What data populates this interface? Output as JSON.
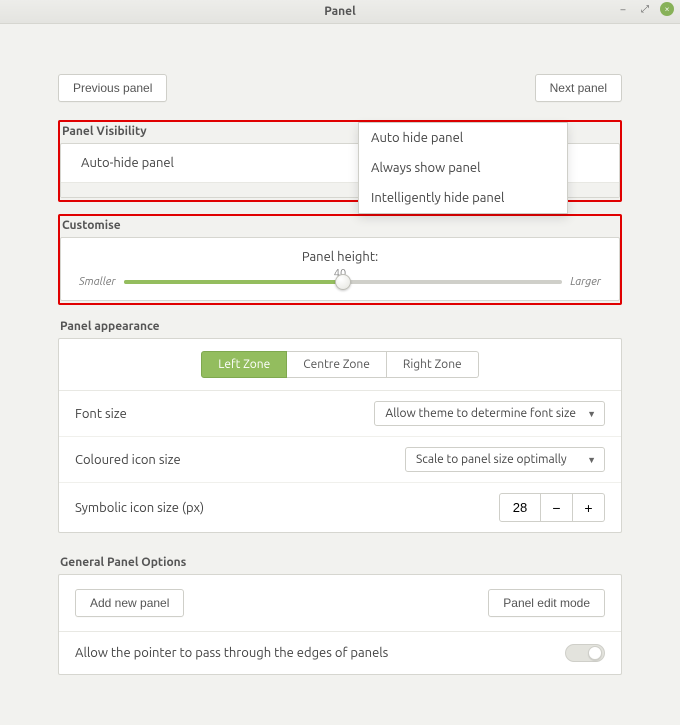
{
  "window": {
    "title": "Panel"
  },
  "nav": {
    "prev": "Previous panel",
    "next": "Next panel"
  },
  "visibility": {
    "heading": "Panel Visibility",
    "current": "Auto-hide panel",
    "options": [
      "Auto hide panel",
      "Always show panel",
      "Intelligently hide panel"
    ]
  },
  "customise": {
    "heading": "Customise",
    "label": "Panel height:",
    "value": "40",
    "min_label": "Smaller",
    "max_label": "Larger"
  },
  "appearance": {
    "heading": "Panel appearance",
    "zones": {
      "left": "Left Zone",
      "centre": "Centre Zone",
      "right": "Right Zone"
    },
    "font_size": {
      "label": "Font size",
      "value": "Allow theme to determine font size"
    },
    "icon_size": {
      "label": "Coloured icon size",
      "value": "Scale to panel size optimally"
    },
    "symbolic": {
      "label": "Symbolic icon size (px)",
      "value": "28"
    }
  },
  "general": {
    "heading": "General Panel Options",
    "add": "Add new panel",
    "edit": "Panel edit mode",
    "pointer": "Allow the pointer to pass through the edges of panels",
    "pointer_enabled": false
  }
}
